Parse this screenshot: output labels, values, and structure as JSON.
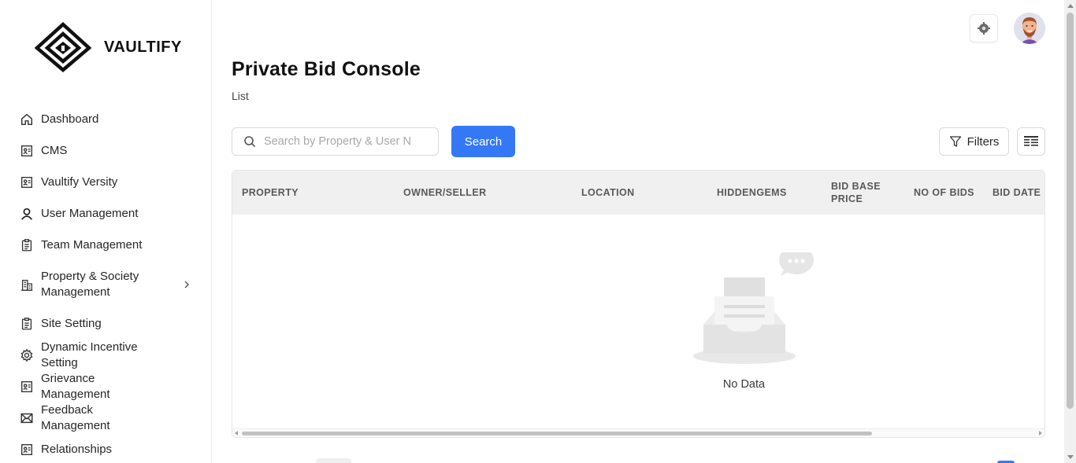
{
  "brand": {
    "name": "VAULTIFY"
  },
  "sidebar": {
    "items": [
      {
        "label": "Dashboard",
        "icon": "home-icon"
      },
      {
        "label": "CMS",
        "icon": "id-card-icon"
      },
      {
        "label": "Vaultify Versity",
        "icon": "id-card-icon"
      },
      {
        "label": "User Management",
        "icon": "user-icon"
      },
      {
        "label": "Team Management",
        "icon": "clipboard-icon"
      },
      {
        "label": "Property & Society Management",
        "icon": "building-icon",
        "has_submenu": true
      },
      {
        "label": "Site Setting",
        "icon": "clipboard-icon"
      },
      {
        "label": "Dynamic Incentive Setting",
        "icon": "gear-icon"
      },
      {
        "label": "Grievance Management",
        "icon": "id-card-icon"
      },
      {
        "label": "Feedback Management",
        "icon": "mail-icon"
      },
      {
        "label": "Relationships",
        "icon": "id-card-icon"
      }
    ]
  },
  "header": {
    "settings_icon": "gear-icon",
    "avatar_icon": "user-avatar"
  },
  "main": {
    "title": "Private Bid Console",
    "subtitle": "List",
    "search": {
      "placeholder": "Search by Property & User N",
      "value": "",
      "button_label": "Search"
    },
    "filters_label": "Filters",
    "columns_icon": "columns-icon",
    "table": {
      "columns": [
        "PROPERTY",
        "OWNER/SELLER",
        "LOCATION",
        "HIDDENGEMS",
        "BID BASE PRICE",
        "NO OF BIDS",
        "BID DATE"
      ],
      "rows": [],
      "empty_text": "No Data"
    }
  },
  "colors": {
    "primary": "#3478f6",
    "header_bg": "#f0f0f0",
    "border": "#d9d9d9"
  }
}
